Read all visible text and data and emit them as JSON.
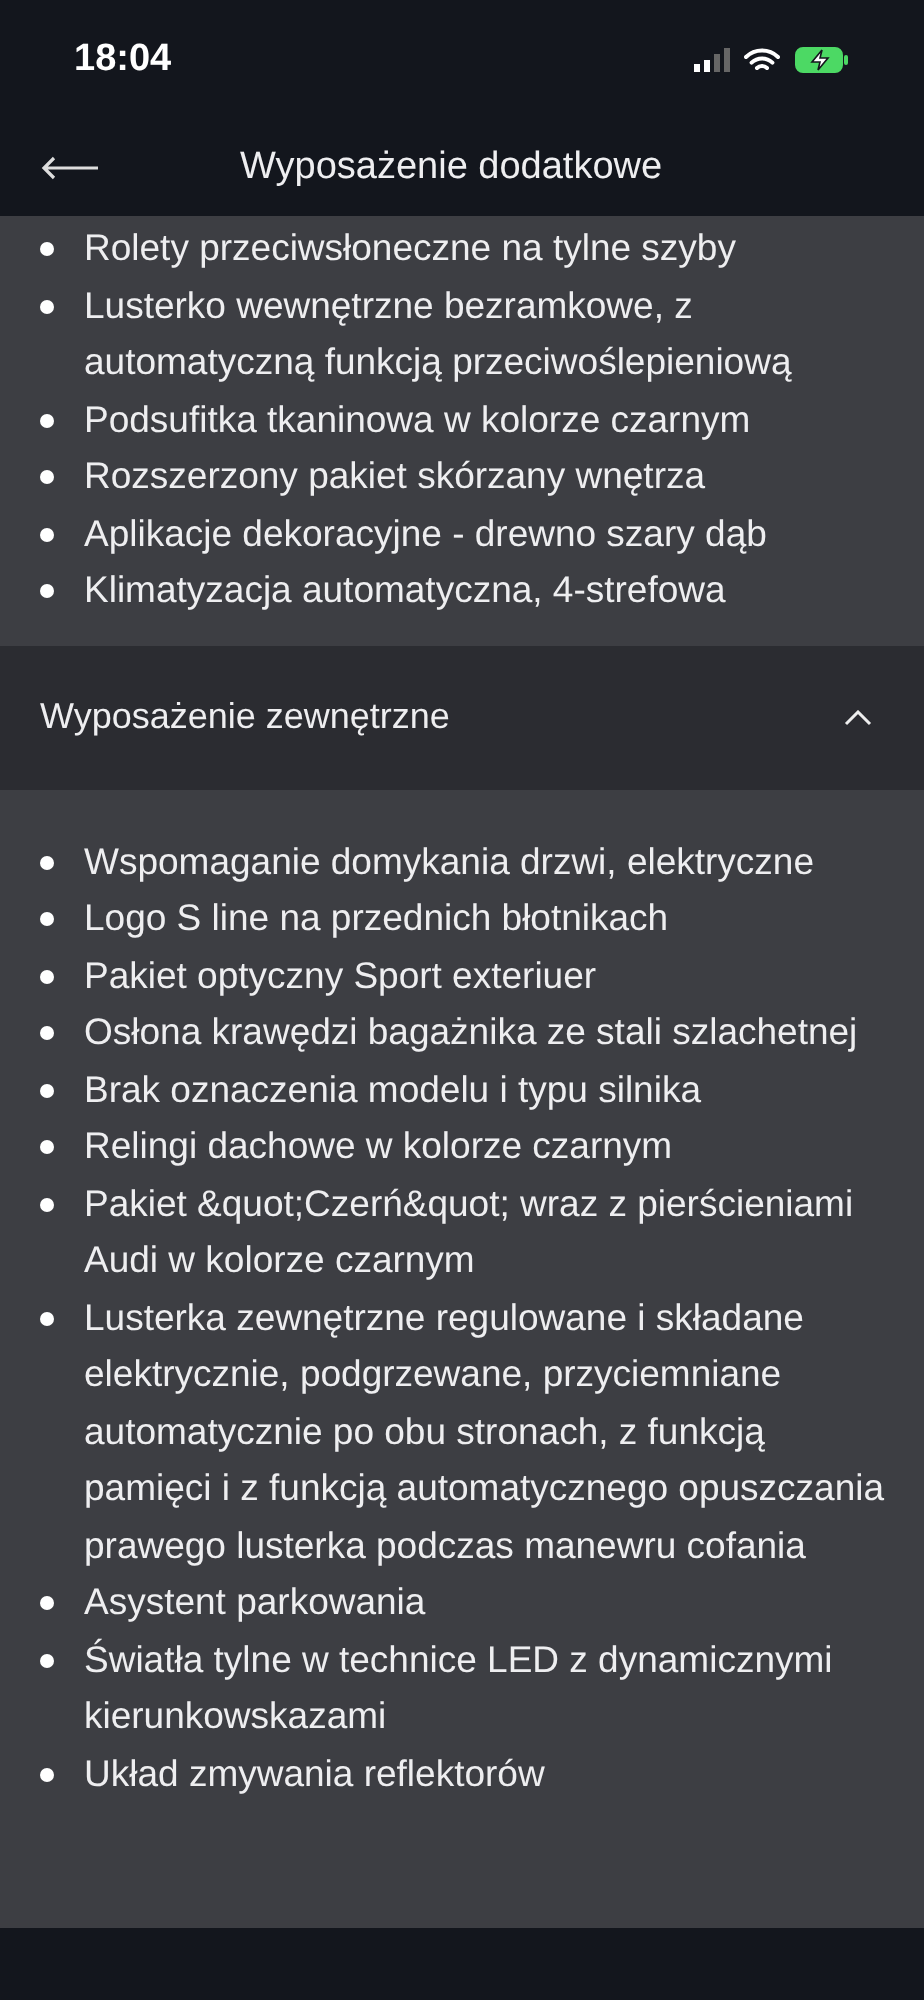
{
  "status_bar": {
    "time": "18:04"
  },
  "header": {
    "title": "Wyposażenie dodatkowe"
  },
  "top_list": [
    "Rolety przeciwsłoneczne na tylne szyby",
    "Lusterko wewnętrzne bezramkowe, z automatyczną funkcją przeciwoślepieniową",
    "Podsufitka tkaninowa w kolorze czarnym",
    "Rozszerzony pakiet skórzany wnętrza",
    "Aplikacje dekoracyjne - drewno szary dąb",
    "Klimatyzacja automatyczna, 4-strefowa"
  ],
  "section": {
    "title": "Wyposażenie zewnętrzne",
    "expanded": true,
    "items": [
      "Wspomaganie domykania drzwi, elektryczne",
      "Logo S line na przednich błotnikach",
      "Pakiet optyczny Sport exteriuer",
      "Osłona krawędzi bagażnika ze stali szlachetnej",
      "Brak oznaczenia modelu i typu silnika",
      "Relingi dachowe w kolorze czarnym",
      "Pakiet &quot;Czerń&quot; wraz z pierścieniami Audi w kolorze czarnym",
      "Lusterka zewnętrzne regulowane i składane elektrycznie, podgrzewane, przyciemniane automatycznie po obu stronach, z funkcją pamięci i z funkcją automatycznego opuszczania prawego lusterka podczas manewru cofania",
      "Asystent parkowania",
      "Światła tylne w technice LED z dynamicznymi kierunkowskazami",
      "Układ zmywania reflektorów"
    ]
  }
}
